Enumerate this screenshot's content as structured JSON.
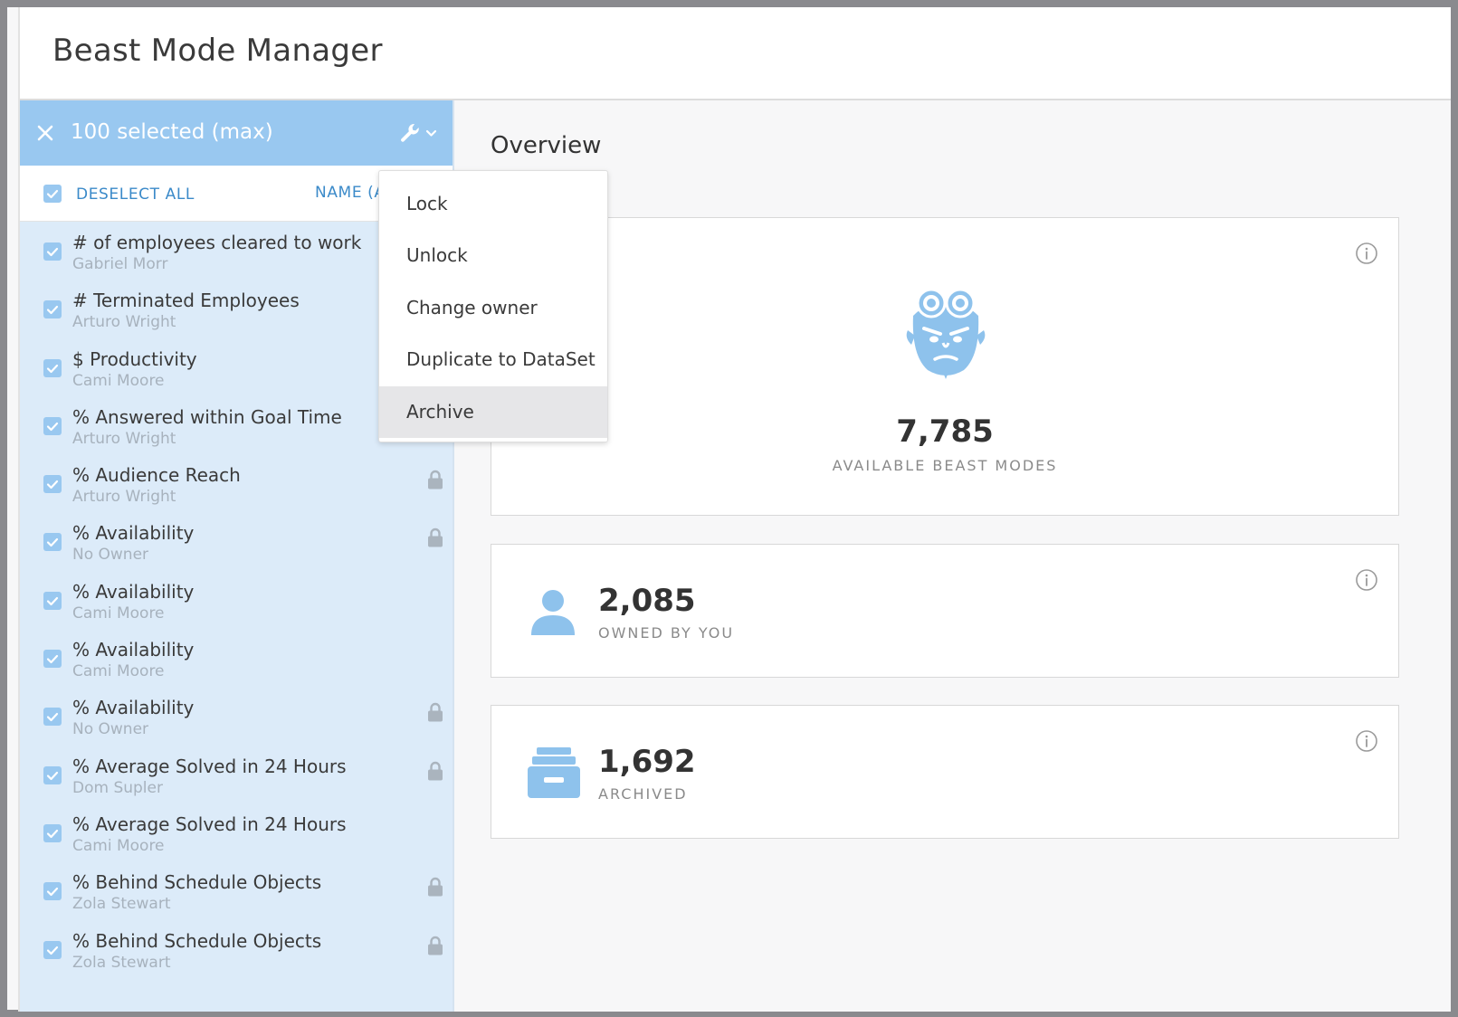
{
  "app": {
    "title": "Beast Mode Manager"
  },
  "selection_bar": {
    "count_label": "100 selected (max)"
  },
  "list_header": {
    "deselect_label": "DESELECT ALL",
    "sort_label": "NAME (A"
  },
  "list": {
    "items": [
      {
        "name": "# of employees cleared to work",
        "owner": "Gabriel Morr",
        "locked": false
      },
      {
        "name": "# Terminated Employees",
        "owner": "Arturo Wright",
        "locked": false
      },
      {
        "name": "$ Productivity",
        "owner": "Cami Moore",
        "locked": false
      },
      {
        "name": "% Answered within Goal Time",
        "owner": "Arturo Wright",
        "locked": false
      },
      {
        "name": "% Audience Reach",
        "owner": "Arturo Wright",
        "locked": true
      },
      {
        "name": "% Availability",
        "owner": "No Owner",
        "locked": true
      },
      {
        "name": "% Availability",
        "owner": "Cami Moore",
        "locked": false
      },
      {
        "name": "% Availability",
        "owner": "Cami Moore",
        "locked": false
      },
      {
        "name": "% Availability",
        "owner": "No Owner",
        "locked": true
      },
      {
        "name": "% Average Solved in 24 Hours",
        "owner": "Dom Supler",
        "locked": true
      },
      {
        "name": "% Average Solved in 24 Hours",
        "owner": "Cami Moore",
        "locked": false
      },
      {
        "name": "% Behind Schedule Objects",
        "owner": "Zola Stewart",
        "locked": true
      },
      {
        "name": "% Behind Schedule Objects",
        "owner": "Zola Stewart",
        "locked": true
      }
    ]
  },
  "menu": {
    "items": [
      {
        "label": "Lock"
      },
      {
        "label": "Unlock"
      },
      {
        "label": "Change owner"
      },
      {
        "label": "Duplicate to DataSet"
      },
      {
        "label": "Archive",
        "active": true
      }
    ]
  },
  "overview": {
    "title": "Overview",
    "available": {
      "value": "7,785",
      "caption": "AVAILABLE BEAST MODES"
    },
    "owned": {
      "value": "2,085",
      "caption": "OWNED BY YOU"
    },
    "archived": {
      "value": "1,692",
      "caption": "ARCHIVED"
    }
  },
  "colors": {
    "accent": "#99c8f0",
    "panel_bg": "#dcebf9",
    "link": "#3b8ac9",
    "icon_blue": "#8ec2ec"
  },
  "icons": {
    "close": "close-icon",
    "wrench": "wrench-icon",
    "chevron": "chevron-down-icon",
    "checkbox": "checkbox-checked-icon",
    "lock": "lock-icon",
    "info": "info-icon",
    "mascot": "beast-mode-mascot-icon",
    "person": "person-icon",
    "archive": "archive-box-icon"
  }
}
